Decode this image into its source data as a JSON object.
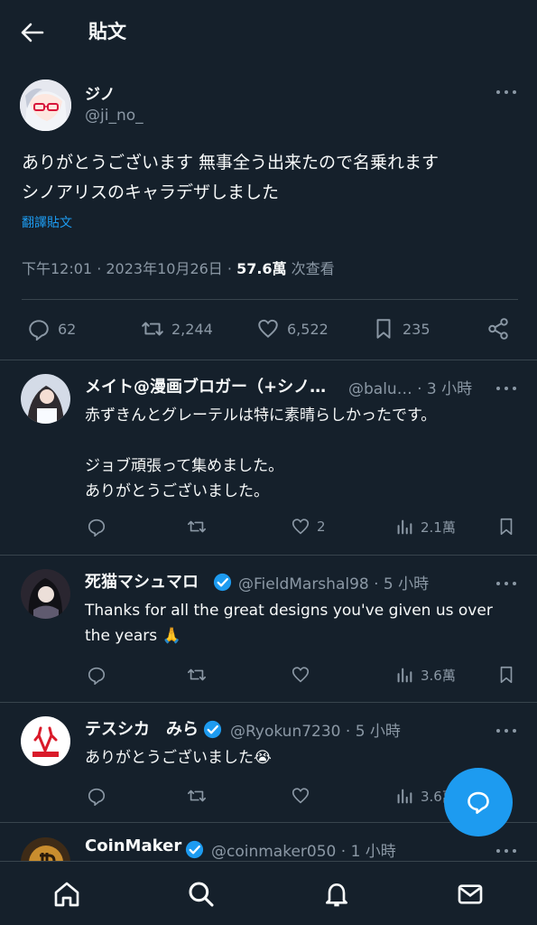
{
  "header": {
    "title": "貼文"
  },
  "post": {
    "author_name": "ジノ",
    "author_handle": "@ji_no_",
    "text": "ありがとうございます 無事全う出来たので名乗れます\nシノアリスのキャラデザしました",
    "translate_label": "翻譯貼文",
    "timestamp": "下午12:01 · 2023年10月26日 ·",
    "views_count": "57.6萬",
    "views_label": "次查看",
    "replies": "62",
    "reposts": "2,244",
    "likes": "6,522",
    "bookmarks": "235"
  },
  "replies": [
    {
      "name": "メイト@漫画ブロガー（+シノ…",
      "handle": "@balu… · 3 小時",
      "text": "赤ずきんとグレーテルは特に素晴らしかったです。\n\nジョブ頑張って集めました。\nありがとうございました。",
      "likes": "2",
      "views": "2.1萬"
    },
    {
      "name": "死猫マシュマロ",
      "handle": "@FieldMarshal98 · 5 小時",
      "text": "Thanks for all the great designs you've given us over the years 🙏",
      "likes": "",
      "views": "3.6萬"
    },
    {
      "name": "テスシカ　みら",
      "handle": "@Ryokun7230 · 5 小時",
      "text": "ありがとうございました😭",
      "likes": "",
      "views": "3.6萬"
    },
    {
      "name": "CoinMaker",
      "handle": "@coinmaker050 · 1 小時"
    }
  ],
  "colors": {
    "background": "#15202b",
    "accent": "#1d9bf0",
    "muted": "#8b98a5",
    "divider": "#38444d"
  }
}
